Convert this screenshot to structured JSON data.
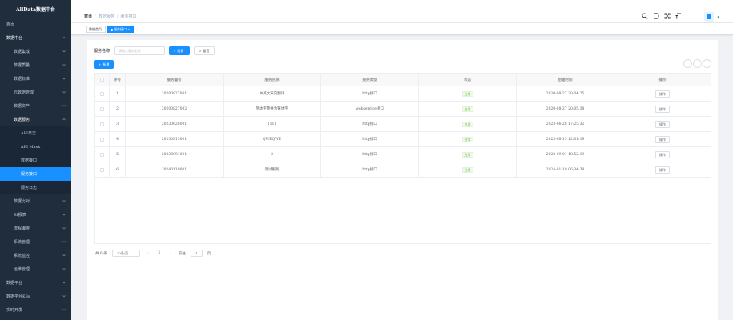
{
  "app": {
    "title": "AllData数据中台"
  },
  "sidebar": {
    "items": [
      {
        "label": "首页",
        "level": 0,
        "chevron": false
      },
      {
        "label": "数据中台",
        "level": 0,
        "chevron": true,
        "open": true
      },
      {
        "label": "数据集成",
        "level": 1,
        "chevron": true
      },
      {
        "label": "数据质量",
        "level": 1,
        "chevron": true
      },
      {
        "label": "数据标准",
        "level": 1,
        "chevron": true
      },
      {
        "label": "元数据管理",
        "level": 1,
        "chevron": true
      },
      {
        "label": "数据资产",
        "level": 1,
        "chevron": true
      },
      {
        "label": "数据服务",
        "level": 1,
        "chevron": true,
        "open": true
      },
      {
        "label": "API日志",
        "level": 2
      },
      {
        "label": "API Mask",
        "level": 2
      },
      {
        "label": "数据接口",
        "level": 2
      },
      {
        "label": "服务接口",
        "level": 2,
        "active": true
      },
      {
        "label": "服务日志",
        "level": 2
      },
      {
        "label": "数据比对",
        "level": 1,
        "chevron": true
      },
      {
        "label": "BI报表",
        "level": 1,
        "chevron": true
      },
      {
        "label": "流程编排",
        "level": 1,
        "chevron": true
      },
      {
        "label": "系统管理",
        "level": 1,
        "chevron": true
      },
      {
        "label": "系统监控",
        "level": 1,
        "chevron": true
      },
      {
        "label": "运维管理",
        "level": 1,
        "chevron": true
      },
      {
        "label": "数据平台",
        "level": 0,
        "chevron": true
      },
      {
        "label": "数据平台K8s",
        "level": 0,
        "chevron": true
      },
      {
        "label": "实时开发",
        "level": 0,
        "chevron": true
      }
    ]
  },
  "header": {
    "breadcrumb": [
      "首页",
      "数据服务",
      "服务接口"
    ],
    "icons": [
      "search-icon",
      "document-icon",
      "fullscreen-icon",
      "font-size-icon"
    ],
    "caret": "▾"
  },
  "tags": {
    "items": [
      "数据首页",
      "服务接口"
    ],
    "close": "×"
  },
  "search": {
    "label": "服务名称",
    "placeholder": "请输入服务名称",
    "search_btn": "搜索",
    "reset_btn": "重置",
    "search_icon": "⌕",
    "reset_icon": "↻"
  },
  "toolbar": {
    "add_btn": "新增",
    "add_icon": "+"
  },
  "table": {
    "headers": [
      "",
      "序号",
      "服务编号",
      "服务名称",
      "服务类型",
      "状态",
      "创建时间",
      "操作"
    ],
    "rows": [
      {
        "index": "1",
        "code": "20200827001",
        "name": "中英文双向翻译",
        "type": "http接口",
        "status": "启用",
        "time": "2020-08-27 20:04:25",
        "op": "操作"
      },
      {
        "index": "2",
        "code": "20200827002",
        "name": "简体字转换为繁体字",
        "type": "webservice接口",
        "status": "启用",
        "time": "2020-08-27 20:05:38",
        "op": "操作"
      },
      {
        "index": "3",
        "code": "20230628001",
        "name": "1111",
        "type": "http接口",
        "status": "启用",
        "time": "2023-06-28 17:25:32",
        "op": "操作"
      },
      {
        "index": "4",
        "code": "20230815001",
        "name": "QWEQWE",
        "type": "http接口",
        "status": "启用",
        "time": "2023-08-15 12:01:19",
        "op": "操作"
      },
      {
        "index": "5",
        "code": "20230901001",
        "name": "2",
        "type": "http接口",
        "status": "启用",
        "time": "2023-09-01 18:52:19",
        "op": "操作"
      },
      {
        "index": "6",
        "code": "20240119001",
        "name": "测试服务",
        "type": "http接口",
        "status": "启用",
        "time": "2024-01-19 06:34:38",
        "op": "操作"
      }
    ]
  },
  "pagination": {
    "total": "共 6 条",
    "page_size": "20条/页",
    "prev": "‹",
    "current": "1",
    "next": "›",
    "goto_label": "前往",
    "goto_value": "1",
    "page_suffix": "页"
  },
  "colors": {
    "primary": "#1890ff",
    "sidebar_bg": "#1f2d3d",
    "success": "#67c23a"
  }
}
